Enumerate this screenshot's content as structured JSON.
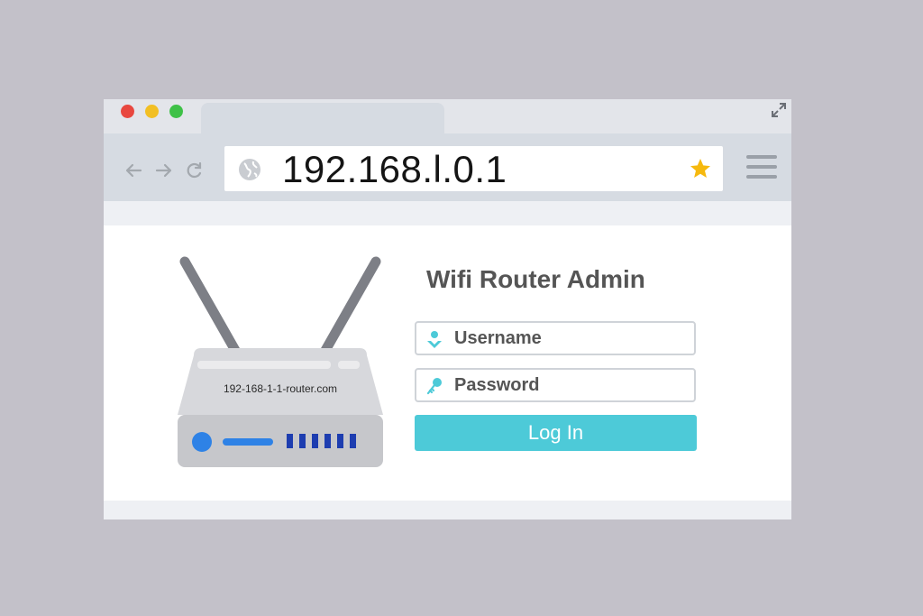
{
  "browser": {
    "address_bar": {
      "url": "192.168.l.0.1",
      "favicon": "globe-icon",
      "bookmark_icon": "star-icon",
      "bookmark_color": "#f6b90e"
    },
    "nav": {
      "back_icon": "arrow-left-icon",
      "forward_icon": "arrow-right-icon",
      "reload_icon": "reload-icon",
      "menu_icon": "hamburger-menu-icon"
    },
    "window_controls": {
      "close_color": "#e8473f",
      "minimize_color": "#f2bf24",
      "maximize_color": "#3ec147",
      "expand_icon": "expand-arrows-icon"
    }
  },
  "router": {
    "label": "192-168-1-1-router.com"
  },
  "login_form": {
    "title": "Wifi Router Admin",
    "username_placeholder": "Username",
    "password_placeholder": "Password",
    "login_label": "Log In",
    "accent_color": "#4dcad8"
  }
}
